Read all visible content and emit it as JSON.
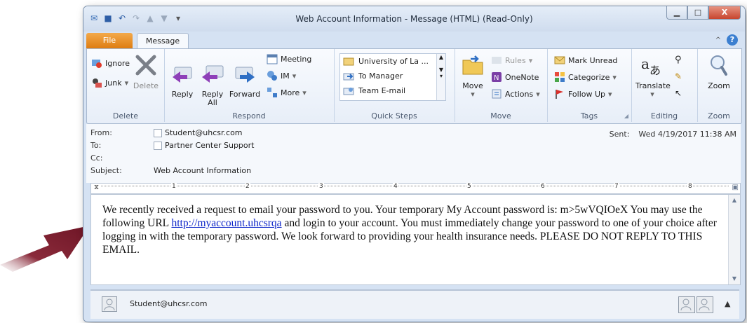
{
  "window": {
    "title": "Web Account Information  -  Message (HTML) (Read-Only)",
    "controls": {
      "minimize": "▁",
      "maximize": "□",
      "close": "X"
    }
  },
  "tabs": {
    "file": "File",
    "message": "Message",
    "collapse_icon": "^"
  },
  "ribbon": {
    "delete_group": {
      "ignore": "Ignore",
      "junk": "Junk",
      "delete": "Delete",
      "label": "Delete"
    },
    "respond_group": {
      "reply": "Reply",
      "reply_all_line1": "Reply",
      "reply_all_line2": "All",
      "forward": "Forward",
      "meeting": "Meeting",
      "im": "IM",
      "more": "More",
      "label": "Respond"
    },
    "quicksteps_group": {
      "items": [
        "University of La ...",
        "To Manager",
        "Team E-mail"
      ],
      "label": "Quick Steps"
    },
    "move_group": {
      "move": "Move",
      "rules": "Rules",
      "onenote": "OneNote",
      "actions": "Actions",
      "label": "Move"
    },
    "tags_group": {
      "mark_unread": "Mark Unread",
      "categorize": "Categorize",
      "follow_up": "Follow Up",
      "label": "Tags"
    },
    "editing_group": {
      "translate": "Translate",
      "label": "Editing"
    },
    "zoom_group": {
      "zoom": "Zoom",
      "label": "Zoom"
    }
  },
  "header": {
    "from_label": "From:",
    "from_value": "Student@uhcsr.com",
    "to_label": "To:",
    "to_value": "Partner Center Support",
    "cc_label": "Cc:",
    "subject_label": "Subject:",
    "subject_value": "Web Account Information",
    "sent_label": "Sent:",
    "sent_value": "Wed 4/19/2017 11:38 AM"
  },
  "ruler": {
    "marks": [
      "1",
      "2",
      "3",
      "4",
      "5",
      "6",
      "7",
      "8"
    ]
  },
  "message": {
    "part1": "We recently received a request to email your password to you. Your temporary My Account password is: m>5wVQIOeX You may use the following URL ",
    "link": "http://myaccount.uhcsrqa",
    "part2": " and login to your account. You must immediately change your password to one of your choice after logging in with the temporary password. We look forward to providing your health insurance needs. PLEASE DO NOT REPLY TO THIS EMAIL."
  },
  "people_pane": {
    "name": "Student@uhcsr.com"
  },
  "colors": {
    "arrow": "#7c1f2f",
    "file_tab": "#e88a1e",
    "link": "#0b23c8"
  }
}
